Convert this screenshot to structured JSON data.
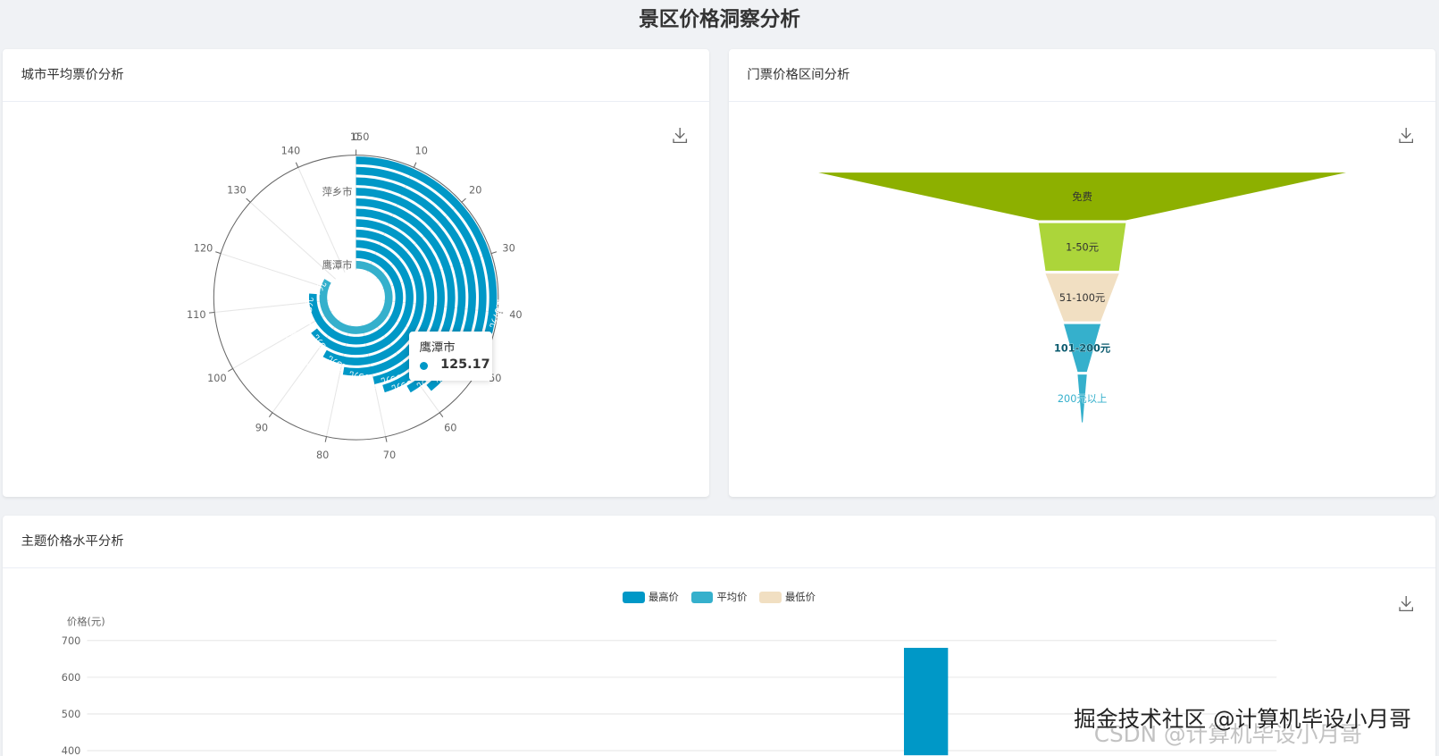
{
  "page_title": "景区价格洞察分析",
  "colors": {
    "primary": "#0098c7",
    "highlight": "#35b0cc",
    "free": "#8db000",
    "low": "#acd53a",
    "mid": "#f1dfc2",
    "high": "#35b0cc"
  },
  "cards": {
    "city": {
      "title": "城市平均票价分析"
    },
    "range": {
      "title": "门票价格区间分析"
    },
    "theme": {
      "title": "主题价格水平分析"
    }
  },
  "download_icon": "download-icon",
  "tooltip": {
    "name": "鹰潭市",
    "value": "125.17"
  },
  "watermark": {
    "line1": "掘金技术社区 @计算机毕设小月哥",
    "line2": "CSDN @计算机毕设小月哥"
  },
  "chart_data": [
    {
      "type": "polar-bar",
      "title": "城市平均票价分析",
      "angle_range": [
        0,
        150
      ],
      "angle_ticks": [
        "0",
        "10",
        "20",
        "30",
        "40",
        "50",
        "60",
        "70",
        "80",
        "90",
        "100",
        "110",
        "120",
        "130",
        "140",
        "150"
      ],
      "radial_labels": [
        "鹰潭市",
        "萍乡市"
      ],
      "bars": [
        {
          "name": "鹰潭市",
          "value": 125.17,
          "label": "鹰潭市: 125.17元"
        },
        {
          "name": "宜春市",
          "value": 114.5,
          "label": "宜春市: 114.5元"
        },
        {
          "name": "吉安市",
          "value": 96.5,
          "label": "吉安市: 96.5元"
        },
        {
          "name": "上饶市",
          "value": 87.15,
          "label": "上饶市: 87.15元"
        },
        {
          "name": "抚州市",
          "value": 79.03,
          "label": "抚州市: 79.03元"
        },
        {
          "name": "南昌市",
          "value": 69.99,
          "label": "南昌市: 69.99元"
        },
        {
          "name": "九江市",
          "value": 67.99,
          "label": "九江市: 67.99元"
        },
        {
          "name": "萍乡市",
          "value": 62.55,
          "label": "萍乡市: 62.55元"
        },
        {
          "name": "赣州市",
          "value": 58.82,
          "label": "赣州市: 58.82元"
        },
        {
          "name": "景德镇市",
          "value": 49.46,
          "label": "景德镇市: 49.46元"
        },
        {
          "name": "新余市",
          "value": 44.67,
          "label": "新余市: 44.67元"
        }
      ]
    },
    {
      "type": "funnel",
      "title": "门票价格区间分析",
      "items": [
        {
          "name": "免费",
          "value": 100
        },
        {
          "name": "1-50元",
          "value": 17
        },
        {
          "name": "51-100元",
          "value": 14
        },
        {
          "name": "101-200元",
          "value": 7
        },
        {
          "name": "200元以上",
          "value": 2
        }
      ]
    },
    {
      "type": "bar",
      "title": "主题价格水平分析",
      "ylabel": "价格(元)",
      "legend": [
        "最高价",
        "平均价",
        "最低价"
      ],
      "yticks": [
        "700",
        "600",
        "500",
        "400"
      ],
      "ylim_visible": [
        400,
        700
      ],
      "series": [
        {
          "name": "最高价",
          "values": [
            680
          ]
        }
      ]
    }
  ]
}
